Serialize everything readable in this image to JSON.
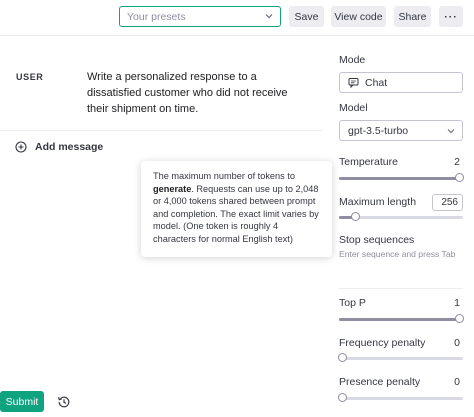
{
  "topbar": {
    "presets_placeholder": "Your presets",
    "save_label": "Save",
    "view_code_label": "View code",
    "share_label": "Share",
    "more_label": "···"
  },
  "conversation": {
    "role": "USER",
    "message": "Write a personalized response to a dissatisfied customer who did not receive their shipment on time.",
    "add_message_label": "Add message"
  },
  "tooltip": {
    "text_before": "The maximum number of tokens to ",
    "bold": "generate",
    "text_after": ". Requests can use up to 2,048 or 4,000 tokens shared between prompt and completion. The exact limit varies by model. (One token is roughly 4 characters for normal English text)"
  },
  "footer": {
    "submit_label": "Submit"
  },
  "settings": {
    "mode_label": "Mode",
    "mode_value": "Chat",
    "model_label": "Model",
    "model_value": "gpt-3.5-turbo",
    "temperature_label": "Temperature",
    "temperature_value": "2",
    "temperature_fraction": 1.0,
    "max_length_label": "Maximum length",
    "max_length_value": "256",
    "max_length_fraction": 0.125,
    "stop_label": "Stop sequences",
    "stop_placeholder": "Enter sequence and press Tab",
    "top_p_label": "Top P",
    "top_p_value": "1",
    "top_p_fraction": 1.0,
    "frequency_label": "Frequency penalty",
    "frequency_value": "0",
    "frequency_fraction": 0.0,
    "presence_label": "Presence penalty",
    "presence_value": "0",
    "presence_fraction": 0.0
  },
  "colors": {
    "accent": "#10a37f",
    "text": "#353740",
    "track": "#d9d9e3"
  }
}
